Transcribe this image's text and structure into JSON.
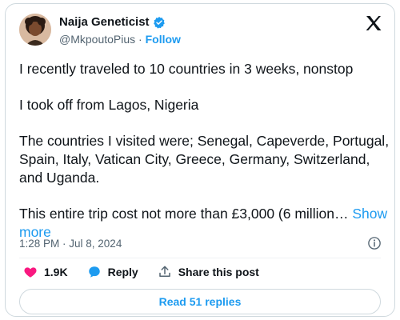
{
  "user": {
    "name": "Naija Geneticist",
    "handle": "@MkpoutoPius",
    "separator": "·",
    "follow_label": "Follow"
  },
  "tweet": {
    "paragraphs": [
      "I recently traveled to 10 countries in 3 weeks, nonstop",
      "I took off from Lagos, Nigeria",
      "The countries I visited were; Senegal, Capeverde, Portugal, Spain, Italy, Vatican City, Greece, Germany, Switzerland, and Uganda.",
      "This entire trip cost not more than £3,000 (6 million…"
    ],
    "show_more": "Show more",
    "timestamp": "1:28 PM · Jul 8, 2024"
  },
  "actions": {
    "likes": "1.9K",
    "reply": "Reply",
    "share": "Share this post"
  },
  "read_replies": "Read 51 replies",
  "icons": {
    "heart": "heart-icon",
    "reply": "speech-bubble-icon",
    "share": "share-icon",
    "info": "info-icon",
    "verified": "verified-badge-icon",
    "logo": "x-logo-icon"
  },
  "colors": {
    "accent": "#1d9bf0",
    "heart": "#f91880",
    "secondary_text": "#536471",
    "border": "#cfd9de"
  }
}
